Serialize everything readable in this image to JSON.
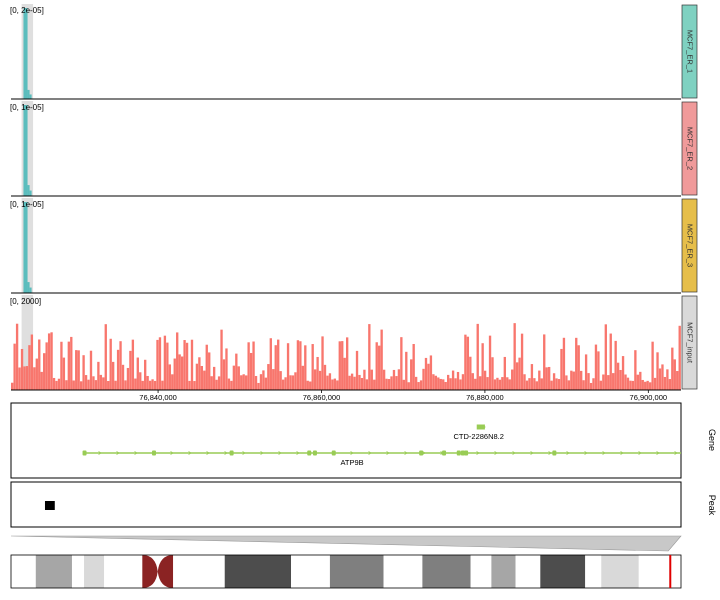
{
  "chart_data": [
    {
      "type": "bar",
      "name": "coverage-tracks",
      "tracks": [
        {
          "name": "MCF7_ER_1",
          "range_label": "[0, 2e-05]",
          "ylim": [
            0,
            2e-05
          ],
          "color": "#5bbdbd",
          "strip_color": "#7fd1c1",
          "peaks": [
            {
              "x": 76823650,
              "y": 2e-05
            },
            {
              "x": 76823900,
              "y": 2e-05
            },
            {
              "x": 76824150,
              "y": 2e-06
            },
            {
              "x": 76824400,
              "y": 1e-06
            }
          ]
        },
        {
          "name": "MCF7_ER_2",
          "range_label": "[0, 1e-05]",
          "ylim": [
            0,
            1e-05
          ],
          "color": "#5bbdbd",
          "strip_color": "#f09a9a",
          "peaks": [
            {
              "x": 76823650,
              "y": 1e-05
            },
            {
              "x": 76823900,
              "y": 1e-05
            },
            {
              "x": 76824150,
              "y": 1.2e-06
            },
            {
              "x": 76824400,
              "y": 6e-07
            }
          ]
        },
        {
          "name": "MCF7_ER_3",
          "range_label": "[0, 1e-05]",
          "ylim": [
            0,
            1e-05
          ],
          "color": "#5bbdbd",
          "strip_color": "#e6be4a",
          "peaks": [
            {
              "x": 76823650,
              "y": 1e-05
            },
            {
              "x": 76823900,
              "y": 1e-05
            },
            {
              "x": 76824150,
              "y": 1.2e-06
            },
            {
              "x": 76824400,
              "y": 6e-07
            }
          ]
        },
        {
          "name": "MCF7_input",
          "range_label": "[0, 2000]",
          "ylim": [
            0,
            2000
          ],
          "color": "#f8766d",
          "strip_color": "#d9d9d9",
          "noise": {
            "bins": 272,
            "max": 1400,
            "seed": 7
          }
        }
      ],
      "xlim": [
        76822000,
        76904000
      ],
      "x_ticks": [
        {
          "value": 76840000,
          "label": "76,840,000"
        },
        {
          "value": 76860000,
          "label": "76,860,000"
        },
        {
          "value": 76880000,
          "label": "76,880,000"
        },
        {
          "value": 76900000,
          "label": "76,900,000"
        }
      ],
      "highlight": [
        76823300,
        76824700
      ]
    },
    {
      "type": "gene_track",
      "label": "Gene",
      "color": "#99cc55",
      "genes": [
        {
          "name": "ATP9B",
          "start": 76831000,
          "end": 76904000,
          "row": 1,
          "exons": [
            76831000,
            76839500,
            76849000,
            76858500,
            76859200,
            76861500,
            76872200,
            76875000,
            76876800,
            76877300,
            76877700,
            76888500
          ]
        },
        {
          "name": "CTD-2286N8.2",
          "start": 76879000,
          "end": 76880000,
          "row": 0,
          "exons": [
            76879000
          ]
        }
      ]
    },
    {
      "type": "peak_track",
      "label": "Peak",
      "peaks": [
        {
          "start": 76824200,
          "end": 76825400
        }
      ]
    },
    {
      "type": "ideogram",
      "bands": [
        {
          "start": 0.0,
          "end": 0.037,
          "fill": "#ffffff"
        },
        {
          "start": 0.037,
          "end": 0.091,
          "fill": "#a6a6a6"
        },
        {
          "start": 0.091,
          "end": 0.109,
          "fill": "#ffffff"
        },
        {
          "start": 0.109,
          "end": 0.139,
          "fill": "#d9d9d9"
        },
        {
          "start": 0.139,
          "end": 0.196,
          "fill": "#ffffff"
        },
        {
          "start": 0.196,
          "end": 0.242,
          "fill": "#8b2323",
          "type": "centromere"
        },
        {
          "start": 0.242,
          "end": 0.319,
          "fill": "#ffffff"
        },
        {
          "start": 0.319,
          "end": 0.418,
          "fill": "#4d4d4d"
        },
        {
          "start": 0.418,
          "end": 0.476,
          "fill": "#ffffff"
        },
        {
          "start": 0.476,
          "end": 0.556,
          "fill": "#7f7f7f"
        },
        {
          "start": 0.556,
          "end": 0.614,
          "fill": "#ffffff"
        },
        {
          "start": 0.614,
          "end": 0.686,
          "fill": "#7f7f7f"
        },
        {
          "start": 0.686,
          "end": 0.717,
          "fill": "#ffffff"
        },
        {
          "start": 0.717,
          "end": 0.753,
          "fill": "#a6a6a6"
        },
        {
          "start": 0.753,
          "end": 0.79,
          "fill": "#ffffff"
        },
        {
          "start": 0.79,
          "end": 0.857,
          "fill": "#4d4d4d"
        },
        {
          "start": 0.857,
          "end": 0.881,
          "fill": "#ffffff"
        },
        {
          "start": 0.881,
          "end": 0.937,
          "fill": "#d9d9d9"
        },
        {
          "start": 0.937,
          "end": 1.0,
          "fill": "#ffffff"
        }
      ],
      "marker": 0.984,
      "marker_color": "#e00000"
    }
  ]
}
